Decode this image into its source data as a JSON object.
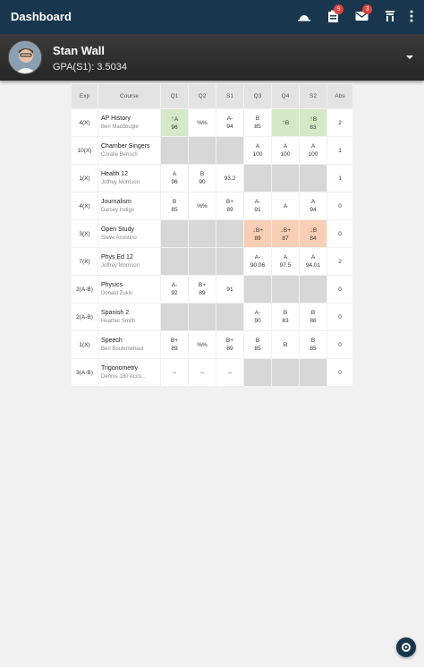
{
  "app": {
    "title": "Dashboard",
    "badges": {
      "assignments": "9",
      "mail": "3"
    }
  },
  "student": {
    "name": "Stan Wall",
    "gpa": "GPA(S1): 3.5034"
  },
  "table": {
    "headers": [
      "Exp",
      "Course",
      "Q1",
      "Q2",
      "S1",
      "Q3",
      "Q4",
      "S2",
      "Abs"
    ],
    "rows": [
      {
        "exp": "4(X)",
        "course": "AP History",
        "teacher": "Ben Macdougle",
        "q1": {
          "g1": "A",
          "g2": "96",
          "status": "up"
        },
        "q2": {
          "g1": "%%",
          "g2": ""
        },
        "s1": {
          "g1": "A-",
          "g2": "94"
        },
        "q3": {
          "g1": "B",
          "g2": "85"
        },
        "q4": {
          "g1": "B",
          "g2": "",
          "status": "up"
        },
        "s2": {
          "g1": "B",
          "g2": "83",
          "status": "up"
        },
        "abs": "2"
      },
      {
        "exp": "10(X)",
        "course": "Chamber Singers",
        "teacher": "Coralie Bensch",
        "q1": {
          "g1": "",
          "g2": "",
          "status": "empty"
        },
        "q2": {
          "g1": "",
          "g2": "",
          "status": "empty"
        },
        "s1": {
          "g1": "",
          "g2": "",
          "status": "empty"
        },
        "q3": {
          "g1": "A",
          "g2": "100"
        },
        "q4": {
          "g1": "A",
          "g2": "100"
        },
        "s2": {
          "g1": "A",
          "g2": "100"
        },
        "abs": "1"
      },
      {
        "exp": "1(X)",
        "course": "Health 12",
        "teacher": "Joffrey Morrison",
        "q1": {
          "g1": "A",
          "g2": "96"
        },
        "q2": {
          "g1": "B",
          "g2": "90"
        },
        "s1": {
          "g1": "93.2",
          "g2": ""
        },
        "q3": {
          "g1": "",
          "g2": "",
          "status": "empty"
        },
        "q4": {
          "g1": "",
          "g2": "",
          "status": "empty"
        },
        "s2": {
          "g1": "",
          "g2": "",
          "status": "empty"
        },
        "abs": "1"
      },
      {
        "exp": "4(X)",
        "course": "Journalism",
        "teacher": "Darcey Indigo",
        "q1": {
          "g1": "B",
          "g2": "85"
        },
        "q2": {
          "g1": "%%",
          "g2": ""
        },
        "s1": {
          "g1": "B+",
          "g2": "89"
        },
        "q3": {
          "g1": "A-",
          "g2": "91"
        },
        "q4": {
          "g1": "A",
          "g2": ""
        },
        "s2": {
          "g1": "A",
          "g2": "94"
        },
        "abs": "0"
      },
      {
        "exp": "3(X)",
        "course": "Open Study",
        "teacher": "Steve Acostino",
        "q1": {
          "g1": "",
          "g2": "",
          "status": "empty"
        },
        "q2": {
          "g1": "",
          "g2": "",
          "status": "empty"
        },
        "s1": {
          "g1": "",
          "g2": "",
          "status": "empty"
        },
        "q3": {
          "g1": "B+",
          "g2": "89",
          "status": "down"
        },
        "q4": {
          "g1": "B+",
          "g2": "87",
          "status": "down"
        },
        "s2": {
          "g1": "B",
          "g2": "84",
          "status": "down"
        },
        "abs": "0"
      },
      {
        "exp": "7(X)",
        "course": "Phys Ed 12",
        "teacher": "Joffrey Morrison",
        "q1": {
          "g1": "",
          "g2": "",
          "status": "empty"
        },
        "q2": {
          "g1": "",
          "g2": "",
          "status": "empty"
        },
        "s1": {
          "g1": "",
          "g2": "",
          "status": "empty"
        },
        "q3": {
          "g1": "A-",
          "g2": "90.06"
        },
        "q4": {
          "g1": "A",
          "g2": "97.5"
        },
        "s2": {
          "g1": "A",
          "g2": "94.01"
        },
        "abs": "2"
      },
      {
        "exp": "2(A-B)",
        "course": "Physics",
        "teacher": "Donald Zukin",
        "q1": {
          "g1": "A-",
          "g2": "92"
        },
        "q2": {
          "g1": "B+",
          "g2": "89"
        },
        "s1": {
          "g1": "91",
          "g2": ""
        },
        "q3": {
          "g1": "",
          "g2": "",
          "status": "empty"
        },
        "q4": {
          "g1": "",
          "g2": "",
          "status": "empty"
        },
        "s2": {
          "g1": "",
          "g2": "",
          "status": "empty"
        },
        "abs": "0"
      },
      {
        "exp": "2(A-B)",
        "course": "Spanish 2",
        "teacher": "Heather Smith",
        "q1": {
          "g1": "",
          "g2": "",
          "status": "empty"
        },
        "q2": {
          "g1": "",
          "g2": "",
          "status": "empty"
        },
        "s1": {
          "g1": "",
          "g2": "",
          "status": "empty"
        },
        "q3": {
          "g1": "A-",
          "g2": "90"
        },
        "q4": {
          "g1": "B",
          "g2": "83"
        },
        "s2": {
          "g1": "B",
          "g2": "86"
        },
        "abs": "0"
      },
      {
        "exp": "1(X)",
        "course": "Speech",
        "teacher": "Ben Boulemebaul",
        "q1": {
          "g1": "B+",
          "g2": "89"
        },
        "q2": {
          "g1": "%%",
          "g2": ""
        },
        "s1": {
          "g1": "B+",
          "g2": "89"
        },
        "q3": {
          "g1": "B",
          "g2": "85"
        },
        "q4": {
          "g1": "B",
          "g2": ""
        },
        "s2": {
          "g1": "B",
          "g2": "85"
        },
        "abs": "0"
      },
      {
        "exp": "3(A-B)",
        "course": "Trigonometry",
        "teacher": "Dennis 180 Acco...",
        "q1": {
          "g1": "--",
          "g2": ""
        },
        "q2": {
          "g1": "--",
          "g2": ""
        },
        "s1": {
          "g1": "--",
          "g2": ""
        },
        "q3": {
          "g1": "",
          "g2": "",
          "status": "empty"
        },
        "q4": {
          "g1": "",
          "g2": "",
          "status": "empty"
        },
        "s2": {
          "g1": "",
          "g2": "",
          "status": "empty"
        },
        "abs": "0"
      }
    ]
  },
  "icons": {
    "topbar": [
      "weather-icon",
      "assignments-icon",
      "mail-icon",
      "school-icon",
      "more-vert-icon"
    ],
    "trend_up": "arrow-up-icon",
    "trend_down": "arrow-down-icon",
    "fab": "settings-icon"
  },
  "colors": {
    "topbar": "#18374f",
    "trend_up_bg": "#d4e9c5",
    "trend_down_bg": "#f8cfb5",
    "badge": "#e0443a"
  }
}
